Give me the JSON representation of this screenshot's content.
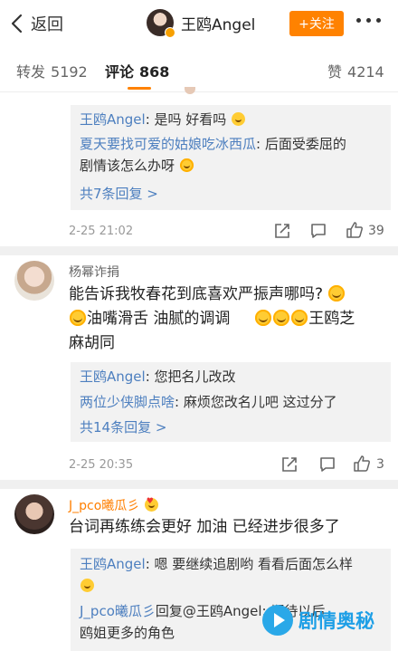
{
  "nav": {
    "back_label": "返回",
    "username": "王鸥Angel",
    "follow_label": "+关注"
  },
  "tabs": [
    {
      "label": "转发",
      "count": "5192"
    },
    {
      "label": "评论",
      "count": "868"
    },
    {
      "label": "赞",
      "count": "4214"
    }
  ],
  "comment1": {
    "replies": [
      {
        "who": "王鸥Angel",
        "text": ": 是吗 好看吗"
      },
      {
        "who": "夏天要找可爱的姑娘吃冰西瓜",
        "text": ": 后面受委屈的"
      },
      {
        "who": "",
        "text": "剧情该怎么办呀"
      }
    ],
    "more": "共7条回复 >",
    "time": "2-25 21:02",
    "likes": "39"
  },
  "comment2": {
    "name": "杨幂诈捐",
    "lines": [
      "能告诉我牧春花到底喜欢严振声哪吗?",
      "油嘴滑舌  油腻的调调",
      "王鸥芝",
      "麻胡同"
    ],
    "replies": [
      {
        "who": "王鸥Angel",
        "text": ": 您把名儿改改"
      },
      {
        "who": "两位少侠脚点啥",
        "text": ": 麻烦您改名儿吧 这过分了"
      }
    ],
    "more": "共14条回复 >",
    "time": "2-25 20:35",
    "likes": "3"
  },
  "comment3": {
    "name": "J_pco曦瓜彡",
    "text": "台词再练练会更好 加油 已经进步很多了",
    "replies": [
      {
        "who": "王鸥Angel",
        "text": ": 嗯 要继续追剧哟 看看后面怎么样"
      },
      {
        "who": "J_pco曦瓜彡",
        "text": "回复@王鸥Angel: 期待以后"
      },
      {
        "who": "",
        "text": "鸥姐更多的角色"
      }
    ]
  },
  "watermark": {
    "text": "剧情奥秘"
  },
  "colors": {
    "accent": "#ff8200",
    "link": "#4d7fbf",
    "reply_bg": "#f2f2f2"
  },
  "icons": [
    "back-chevron-icon",
    "more-dots-icon",
    "share-icon",
    "comment-icon",
    "like-icon",
    "smile-emoji-icon",
    "cry-laugh-emoji-icon"
  ]
}
